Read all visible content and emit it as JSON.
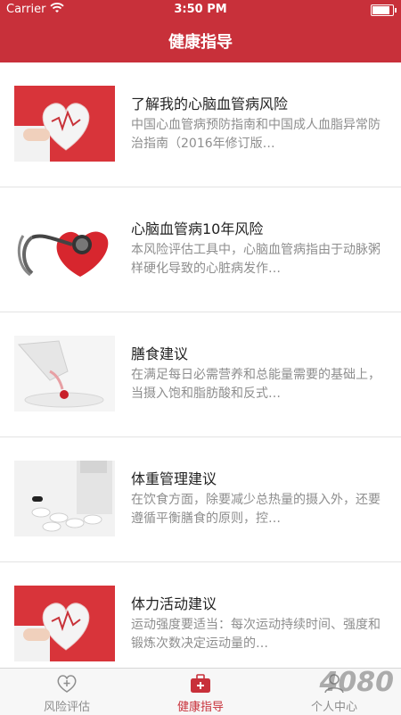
{
  "status": {
    "carrier": "Carrier",
    "time": "3:50 PM",
    "battery_level": 0.95
  },
  "nav": {
    "title": "健康指导"
  },
  "articles": [
    {
      "title": "了解我的心脑血管病风险",
      "desc": "中国心血管病预防指南和中国成人血脂异常防治指南（2016年修订版…",
      "image": "heart-image"
    },
    {
      "title": "心脑血管病10年风险",
      "desc": "本风险评估工具中，心脑血管病指由于动脉粥样硬化导致的心脏病发作…",
      "image": "stethoscope-heart-image"
    },
    {
      "title": "膳食建议",
      "desc": "在满足每日必需营养和总能量需要的基础上，当摄入饱和脂肪酸和反式…",
      "image": "glass-drop-image"
    },
    {
      "title": "体重管理建议",
      "desc": "在饮食方面，除要减少总热量的摄入外，还要遵循平衡膳食的原则，控…",
      "image": "pills-image"
    },
    {
      "title": "体力活动建议",
      "desc": "运动强度要适当：每次运动持续时间、强度和锻炼次数决定运动量的…",
      "image": "heart-image"
    }
  ],
  "tabs": [
    {
      "label": "风险评估",
      "icon": "heart-plus-icon",
      "active": false
    },
    {
      "label": "健康指导",
      "icon": "medical-kit-icon",
      "active": true
    },
    {
      "label": "个人中心",
      "icon": "person-icon",
      "active": false
    }
  ],
  "watermark": "4080",
  "colors": {
    "brand_red": "#c8303a",
    "tab_inactive": "#8e8e8e"
  }
}
